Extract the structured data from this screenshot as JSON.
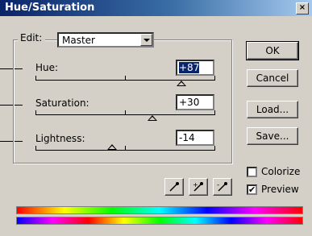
{
  "window": {
    "title": "Hue/Saturation",
    "close_glyph": "×"
  },
  "edit": {
    "label": "Edit:",
    "value": "Master"
  },
  "sliders": {
    "hue": {
      "label": "Hue:",
      "value": "+87"
    },
    "saturation": {
      "label": "Saturation:",
      "value": "+30"
    },
    "lightness": {
      "label": "Lightness:",
      "value": "-14"
    }
  },
  "buttons": {
    "ok": "OK",
    "cancel": "Cancel",
    "load": "Load...",
    "save": "Save..."
  },
  "checkboxes": {
    "colorize": {
      "label": "Colorize",
      "checked": false
    },
    "preview": {
      "label": "Preview",
      "checked": true,
      "mark": "✔"
    }
  },
  "eyedroppers": [
    "eyedropper-icon",
    "eyedropper-plus-icon",
    "eyedropper-minus-icon"
  ]
}
